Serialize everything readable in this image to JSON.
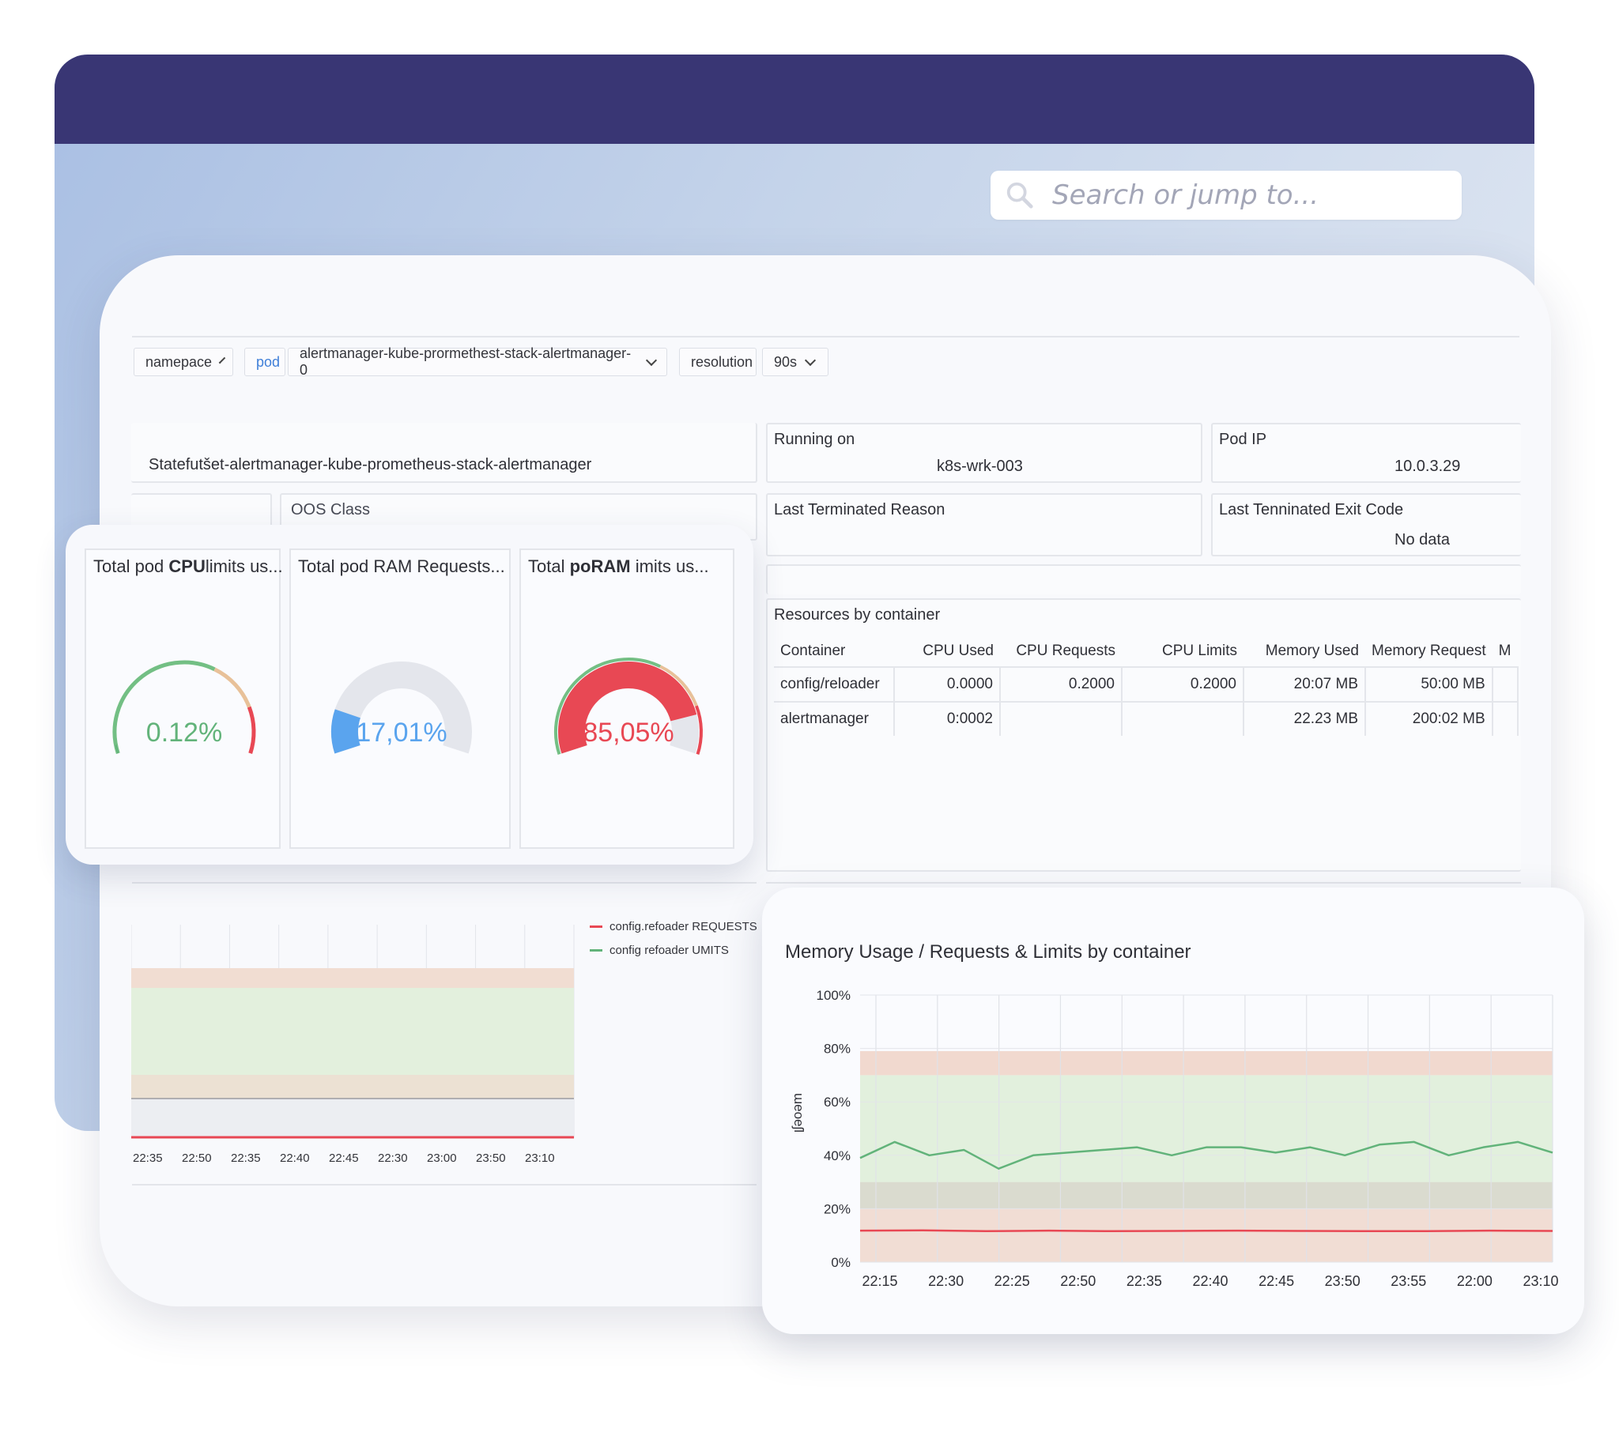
{
  "search": {
    "placeholder": "Search or jump to..."
  },
  "variables": {
    "namespace_label": "namepace",
    "pod_label": "pod",
    "pod_value": "alertmanager-kube-prormethest-stack-alertmanager-0",
    "resolution_label": "resolution",
    "resolution_value": "90s"
  },
  "info": {
    "controller": "Statefutšet-alertmanager-kube-prometheus-stack-alertmanager",
    "running_on_title": "Running on",
    "running_on_value": "k8s-wrk-003",
    "pod_ip_title": "Pod IP",
    "pod_ip_value": "10.0.3.29",
    "qos_title": "OOS Class",
    "last_reason_title": "Last Terminated Reason",
    "last_exit_title": "Last Tenninated Exit Code",
    "last_exit_value": "No data"
  },
  "gauges": [
    {
      "title_pre": "Total pod ",
      "title_bold": "CPU",
      "title_post": "limits us...",
      "value_text": "0.12%",
      "percent": 0.12,
      "color": "#62b37a"
    },
    {
      "title_pre": "Total pod RAM Requests...",
      "title_bold": "",
      "title_post": "",
      "value_text": "17,01%",
      "percent": 17.01,
      "color": "#5aa4ee"
    },
    {
      "title_pre": "Total ",
      "title_bold": "poRAM",
      "title_post": " imits us...",
      "value_text": "85,05%",
      "percent": 85.05,
      "color": "#e84854"
    }
  ],
  "resources": {
    "title": "Resources by container",
    "headers": [
      "Container",
      "CPU Used",
      "CPU Requests",
      "CPU Limits",
      "Memory Used",
      "Memory Request",
      "M"
    ],
    "rows": [
      [
        "config/reloader",
        "0.0000",
        "0.2000",
        "0.2000",
        "20:07 MB",
        "50:00 MB"
      ],
      [
        "alertmanager",
        "0:0002",
        "",
        "",
        "22.23 MB",
        "200:02 MB"
      ]
    ]
  },
  "cpu_chart": {
    "legend": [
      {
        "name": "config.refoader REQUESTS",
        "color": "#e84854"
      },
      {
        "name": "config refoader UMITS",
        "color": "#62b37a"
      }
    ],
    "x_ticks": [
      "22:35",
      "22:50",
      "22:35",
      "22:40",
      "22:45",
      "22:30",
      "23:00",
      "23:50",
      "23:10"
    ]
  },
  "chart_data": {
    "type": "line",
    "title": "Memory Usage / Requests & Limits by container",
    "ylabel": "ɯeoeʃl",
    "ylim": [
      0,
      100
    ],
    "y_ticks": [
      "100%",
      "80%",
      "60%",
      "40%",
      "20%",
      "0%"
    ],
    "categories": [
      "22:15",
      "22:30",
      "22:25",
      "22:50",
      "22:35",
      "22:40",
      "22:45",
      "23:50",
      "23:55",
      "22:00",
      "23:10"
    ],
    "series": [
      {
        "color": "#62b37a",
        "values": [
          39,
          45,
          40,
          42,
          35,
          40,
          41,
          42,
          43,
          40,
          43,
          43,
          41,
          43,
          40,
          44,
          45,
          40,
          43,
          45,
          41
        ]
      },
      {
        "color": "#e84854",
        "values": [
          11.8,
          11.9,
          11.6,
          11.8,
          11.6,
          11.7,
          11.8,
          11.7,
          11.6,
          11.6,
          11.8,
          11.7
        ]
      }
    ],
    "bands": [
      {
        "from": 0,
        "to": 20,
        "color": "#f1ddd4"
      },
      {
        "from": 20,
        "to": 30,
        "color": "#dadbcf"
      },
      {
        "from": 30,
        "to": 70,
        "color": "#e2f0dd"
      },
      {
        "from": 70,
        "to": 79,
        "color": "#f1d9cf"
      }
    ]
  }
}
